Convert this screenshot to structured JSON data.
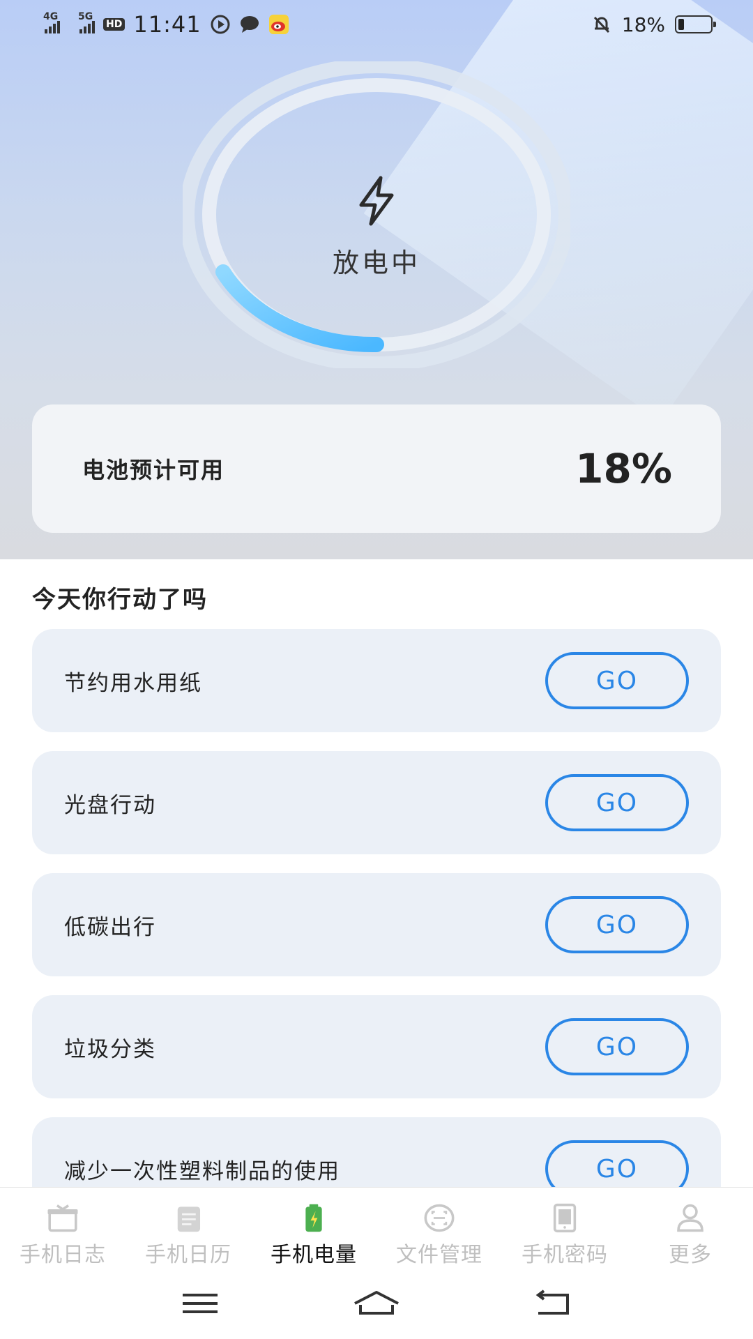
{
  "status_bar": {
    "signal_1": "4G",
    "signal_2": "5G",
    "hd": "HD",
    "time": "11:41",
    "battery_percent": "18%",
    "battery_level": 0.18,
    "icons": [
      "play-icon",
      "chat-bubble-icon",
      "weibo-icon",
      "mute-bell-icon"
    ]
  },
  "hero": {
    "status_label": "放电中",
    "ring_progress": 0.18,
    "colors": {
      "arc": "#5cc3ff",
      "ring": "#e4ecf5"
    }
  },
  "battery_card": {
    "title": "电池预计可用",
    "value": "18%"
  },
  "actions": {
    "section_title": "今天你行动了吗",
    "button_label": "GO",
    "items": [
      {
        "label": "节约用水用纸"
      },
      {
        "label": "光盘行动"
      },
      {
        "label": "低碳出行"
      },
      {
        "label": "垃圾分类"
      },
      {
        "label": "减少一次性塑料制品的使用"
      }
    ]
  },
  "bottom_nav": {
    "items": [
      {
        "label": "手机日志",
        "icon": "gift-box-icon",
        "active": false
      },
      {
        "label": "手机日历",
        "icon": "calendar-note-icon",
        "active": false
      },
      {
        "label": "手机电量",
        "icon": "battery-charge-icon",
        "active": true
      },
      {
        "label": "文件管理",
        "icon": "file-scan-icon",
        "active": false
      },
      {
        "label": "手机密码",
        "icon": "tablet-lock-icon",
        "active": false
      },
      {
        "label": "更多",
        "icon": "person-icon",
        "active": false
      }
    ]
  },
  "colors": {
    "accent": "#2a86e6",
    "active_battery": "#4caf50"
  }
}
